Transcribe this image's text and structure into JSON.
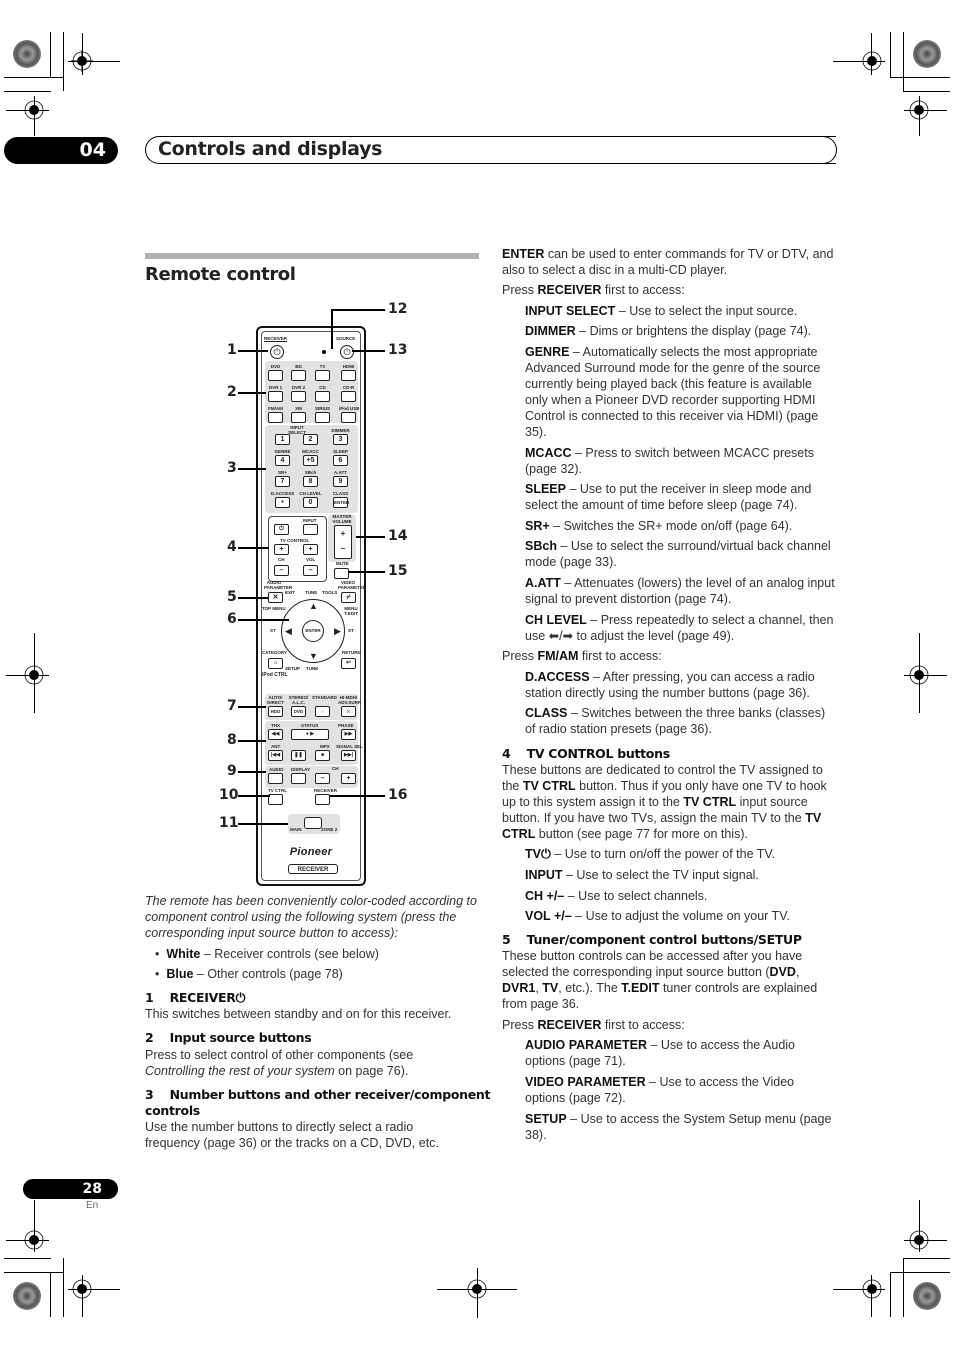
{
  "header": {
    "chapter_number": "04",
    "chapter_title": "Controls and displays"
  },
  "section_title": "Remote control",
  "remote": {
    "receiver_label": "RECEIVER",
    "source_label": "SOURCE",
    "input_buttons": [
      "DVD",
      "BD",
      "TV",
      "HDMI",
      "DVR 1",
      "DVR 2",
      "CD",
      "CD-R",
      "FM/AM",
      "XM",
      "SIRIUS",
      "iPod USB"
    ],
    "input_select_label": "INPUT SELECT",
    "number_labels": [
      "",
      "",
      "DIMMER",
      "GENRE",
      "MCACC",
      "SLEEP",
      "SR+",
      "SBch",
      "A.ATT",
      "D.ACCESS",
      "CH LEVEL",
      "CLASS"
    ],
    "number_keys": [
      "1",
      "2",
      "3",
      "4",
      "+5",
      "6",
      "7",
      "8",
      "9",
      "•",
      "0",
      "ENTER"
    ],
    "tv_input_label": "INPUT",
    "tv_control_label": "TV CONTROL",
    "ch_label": "CH",
    "vol_label": "VOL",
    "master_volume_label": "MASTER VOLUME",
    "mute_label": "MUTE",
    "audio_parameter_label": "AUDIO PARAMETER",
    "video_parameter_label": "VIDEO PARAMETER",
    "exit_label": "EXIT",
    "tune_label": "TUNE",
    "tools_label": "TOOLS",
    "top_menu_label": "TOP MENU",
    "menu_label": "MENU T.EDIT",
    "st_label": "ST",
    "enter_label": "ENTER",
    "category_label": "CATEGORY",
    "setup_label": "SETUP",
    "return_label": "RETURN",
    "ipod_ctrl_label": "iPod CTRL",
    "row7_labels": [
      "AUTO/ DIRECT",
      "STEREO/ A.L.C.",
      "STANDARD",
      "HI-MDH/ ADV.SURR"
    ],
    "row7_keys": [
      "HDD",
      "DVD",
      "⇔",
      "⤫"
    ],
    "row8_labels": [
      "THX",
      "STATUS",
      "PHASE"
    ],
    "row8b_labels": [
      "ANT",
      "MPX",
      "SIGNAL SEL"
    ],
    "row9_labels": [
      "AUDIO",
      "DISPLAY",
      "CH"
    ],
    "tv_ctrl_label": "TV CTRL",
    "receiver_btn_label": "RECEIVER",
    "main_label": "MAIN",
    "zone2_label": "ZONE 2",
    "brand": "Pioneer",
    "model_label": "RECEIVER"
  },
  "callouts": [
    "1",
    "2",
    "3",
    "4",
    "5",
    "6",
    "7",
    "8",
    "9",
    "10",
    "11",
    "12",
    "13",
    "14",
    "15",
    "16"
  ],
  "left_column": {
    "intro": "The remote has been conveniently color-coded according to component control using the following system (press the corresponding input source button to access):",
    "bullets": [
      {
        "bold": "White",
        "text": " – Receiver controls (see below)"
      },
      {
        "bold": "Blue",
        "text": " – Other controls (page 78)"
      }
    ],
    "item1_title": "1    RECEIVER⏻",
    "item1_text": "This switches between standby and on for this receiver.",
    "item2_title": "2    Input source buttons",
    "item2_text_a": "Press to select control of other components (see",
    "item2_text_italic": "Controlling the rest of your system",
    "item2_text_b": " on page 76).",
    "item3_title_a": "3    Number buttons and other receiver/component",
    "item3_title_b": "controls",
    "item3_text": "Use the number buttons to directly select a radio frequency (page 36) or the tracks on a CD, DVD, etc."
  },
  "right_column": {
    "enter_bold": "ENTER",
    "enter_text": " can be used to enter commands for TV or DTV, and also to select a disc in a multi-CD player.",
    "press_receiver_1": {
      "pre": "Press ",
      "bold": "RECEIVER",
      "post": " first to access:"
    },
    "receiver_items": [
      {
        "bold": "INPUT SELECT",
        "text": " – Use to select the input source."
      },
      {
        "bold": "DIMMER",
        "text": " – Dims or brightens the display (page 74)."
      },
      {
        "bold": "GENRE",
        "text": " – Automatically selects the most appropriate Advanced Surround mode for the genre of the source currently being played back (this feature is available only when a Pioneer DVD recorder supporting HDMI Control is connected to this receiver via HDMI) (page 35)."
      },
      {
        "bold": "MCACC",
        "text": " – Press to switch between MCACC presets (page 32)."
      },
      {
        "bold": "SLEEP",
        "text": " – Use to put the receiver in sleep mode and select the amount of time before sleep (page 74)."
      },
      {
        "bold": "SR+",
        "text": " – Switches the SR+ mode on/off (page 64)."
      },
      {
        "bold": "SBch",
        "text": " – Use to select the surround/virtual back channel mode (page 33)."
      },
      {
        "bold": "A.ATT",
        "text": " – Attenuates (lowers) the level of an analog input signal to prevent distortion (page 74)."
      },
      {
        "bold": "CH LEVEL",
        "text": " – Press repeatedly to select a channel, then use ⬅/➡ to adjust the level (page 49)."
      }
    ],
    "press_fmam": {
      "pre": "Press ",
      "bold": "FM/AM",
      "post": " first to access:"
    },
    "fmam_items": [
      {
        "bold": "D.ACCESS",
        "text": " – After pressing, you can access a radio station directly using the number buttons (page 36)."
      },
      {
        "bold": "CLASS",
        "text": " – Switches between the three banks (classes) of radio station presets (page 36)."
      }
    ],
    "item4_title": "4    TV CONTROL buttons",
    "item4_text": {
      "a": "These buttons are dedicated to control the TV assigned to the ",
      "b1": "TV CTRL",
      "c": " button. Thus if you only have one TV to hook up to this system assign it to the ",
      "b2": "TV CTRL",
      "d": " input source button. If you have two TVs, assign the main TV to the ",
      "b3": "TV CTRL",
      "e": " button (see page 77 for more on this)."
    },
    "tv_items": [
      {
        "bold": "TV⏻",
        "text": " – Use to turn on/off the power of the TV."
      },
      {
        "bold": "INPUT",
        "text": " – Use to select the TV input signal."
      },
      {
        "bold": "CH +/–",
        "text": " – Use to select channels."
      },
      {
        "bold": "VOL +/–",
        "text": " – Use to adjust the volume on your TV."
      }
    ],
    "item5_title": "5    Tuner/component control buttons/SETUP",
    "item5_text": {
      "a": "These button controls can be accessed after you have selected the corresponding input source button (",
      "b1": "DVD",
      "c1": ", ",
      "b2": "DVR1",
      "c2": ", ",
      "b3": "TV",
      "c3": ", etc.). The ",
      "b4": "T.EDIT",
      "d": " tuner controls are explained from page 36."
    },
    "press_receiver_2": {
      "pre": "Press ",
      "bold": "RECEIVER",
      "post": " first to access:"
    },
    "setup_items": [
      {
        "bold": "AUDIO PARAMETER",
        "text": " – Use to access the Audio options (page 71)."
      },
      {
        "bold": "VIDEO PARAMETER",
        "text": " – Use to access the Video options (page 72)."
      },
      {
        "bold": "SETUP",
        "text": " – Use to access the System Setup menu (page 38)."
      }
    ]
  },
  "footer": {
    "page_number": "28",
    "language": "En"
  }
}
